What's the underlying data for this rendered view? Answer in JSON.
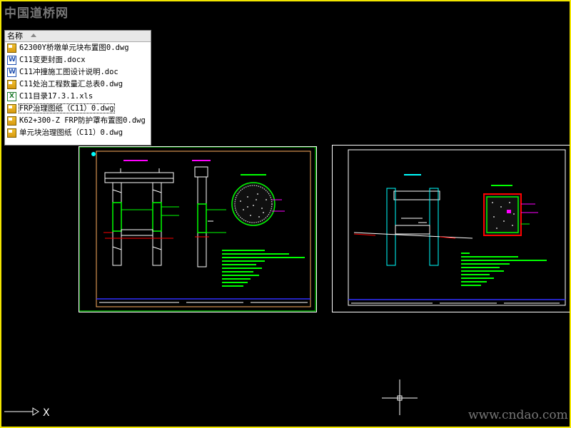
{
  "watermark_top": "中国道桥网",
  "watermark_bottom": "www.cndao.com",
  "file_list": {
    "header": "名称",
    "items": [
      {
        "name": "62300Y桥墩单元块布置图0.dwg",
        "type": "dwg"
      },
      {
        "name": "C11变更封面.docx",
        "type": "doc"
      },
      {
        "name": "C11冲撞施工图设计说明.doc",
        "type": "doc"
      },
      {
        "name": "C11处治工程数量汇总表0.dwg",
        "type": "dwg"
      },
      {
        "name": "C11目录17.3.1.xls",
        "type": "xls"
      },
      {
        "name": "FRP治理图纸（C11）0.dwg",
        "type": "dwg",
        "selected": true
      },
      {
        "name": "K62+300-Z FRP防护罩布置图0.dwg",
        "type": "dwg"
      },
      {
        "name": "单元块治理图纸（C11）0.dwg",
        "type": "dwg"
      }
    ]
  },
  "ucs_label": "X",
  "colors": {
    "background": "#000000",
    "frame_border": "#f2e600",
    "cad_green": "#00ff00",
    "cad_cyan": "#00ffff",
    "cad_magenta": "#ff00ff",
    "cad_red": "#ff0000",
    "cad_blue": "#3030ff",
    "sheet_border_left": "#ffb060"
  }
}
